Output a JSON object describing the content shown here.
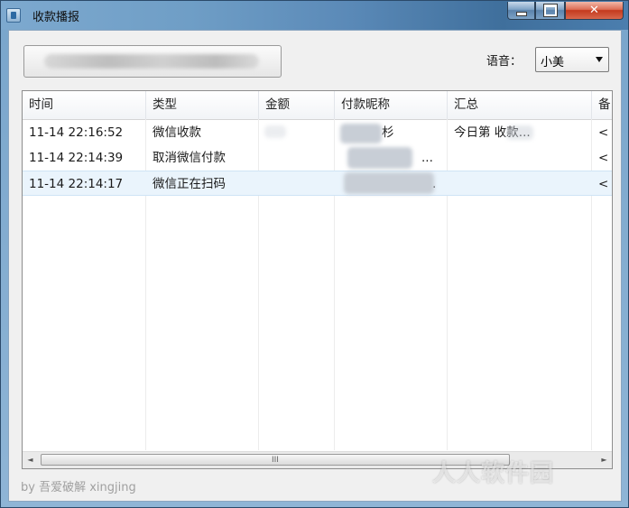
{
  "window": {
    "title": "收款播报"
  },
  "voice": {
    "label": "语音：",
    "selected": "小美"
  },
  "table": {
    "columns": [
      "时间",
      "类型",
      "金额",
      "付款昵称",
      "汇总",
      "备"
    ],
    "rows": [
      {
        "time": "11-14 22:16:52",
        "type": "微信收款",
        "amount": "",
        "nickname": "杉",
        "summary": "今日第     收款...",
        "extra": "<"
      },
      {
        "time": "11-14 22:14:39",
        "type": "取消微信付款",
        "amount": "",
        "nickname": "...",
        "summary": "",
        "extra": "<"
      },
      {
        "time": "11-14 22:14:17",
        "type": "微信正在扫码",
        "amount": "",
        "nickname": ".",
        "summary": "",
        "extra": "<"
      }
    ]
  },
  "scrollbar": {
    "left": "◄",
    "right": "►",
    "grip": "III"
  },
  "footer": {
    "credit": "by 吾爱破解 xingjing"
  },
  "watermark": "人人软件园"
}
